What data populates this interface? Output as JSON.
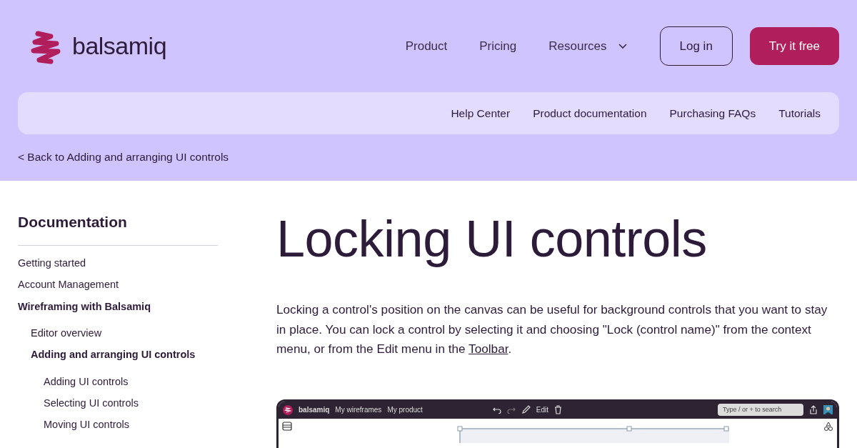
{
  "brand": {
    "name": "balsamiq"
  },
  "nav": [
    {
      "label": "Product",
      "dropdown": false
    },
    {
      "label": "Pricing",
      "dropdown": false
    },
    {
      "label": "Resources",
      "dropdown": true
    }
  ],
  "login": "Log in",
  "cta": "Try it free",
  "subnav": [
    "Help Center",
    "Product documentation",
    "Purchasing FAQs",
    "Tutorials"
  ],
  "back_link": "< Back to Adding and arranging UI controls",
  "sidebar": {
    "title": "Documentation",
    "items": [
      {
        "label": "Getting started",
        "expanded": false
      },
      {
        "label": "Account Management",
        "expanded": false
      },
      {
        "label": "Wireframing with Balsamiq",
        "expanded": true,
        "children": [
          {
            "label": "Editor overview",
            "expanded": false
          },
          {
            "label": "Adding and arranging UI controls",
            "expanded": true,
            "children": [
              {
                "label": "Adding UI controls"
              },
              {
                "label": "Selecting UI controls"
              },
              {
                "label": "Moving UI controls"
              }
            ]
          }
        ]
      }
    ]
  },
  "article": {
    "title": "Locking UI controls",
    "intro": "Locking a control's position on the canvas can be useful for background controls that you want to stay in place. You can lock a control by selecting it and choosing \"Lock (control name)\" from the context menu, or from the Edit menu in the ",
    "intro_link": "Toolbar",
    "intro_end": "."
  },
  "app": {
    "brand": "balsamiq",
    "menus": [
      "My wireframes",
      "My product"
    ],
    "edit": "Edit",
    "search_placeholder": "Type / or + to search"
  }
}
